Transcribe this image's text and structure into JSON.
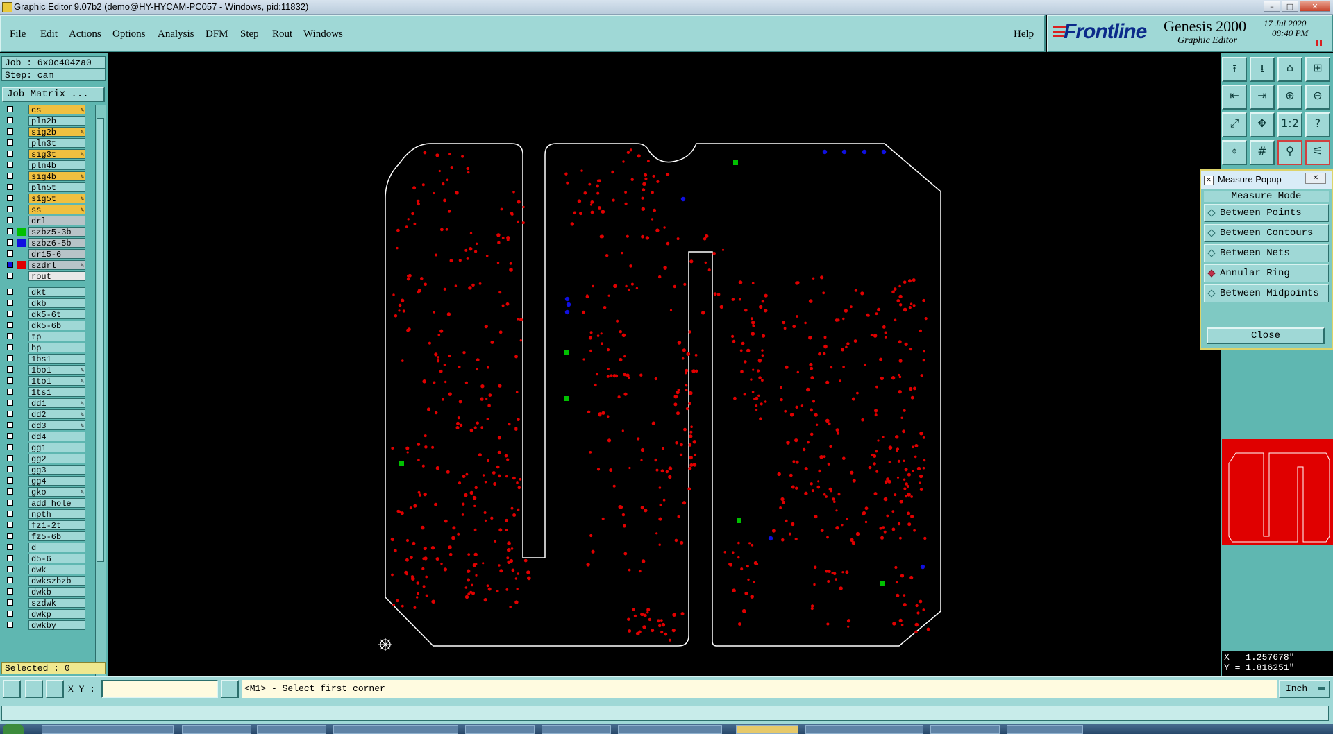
{
  "window": {
    "title": "Graphic Editor 9.07b2 (demo@HY-HYCAM-PC057 - Windows, pid:11832)"
  },
  "menu": [
    "File",
    "Edit",
    "Actions",
    "Options",
    "Analysis",
    "DFM",
    "Step",
    "Rout",
    "Windows"
  ],
  "help_label": "Help",
  "brand": {
    "logo": "Frontline",
    "product": "Genesis 2000",
    "subtitle": "Graphic Editor",
    "date": "17 Jul 2020",
    "time": "08:40 PM"
  },
  "job": {
    "job_line": "Job : 6x0c404za0",
    "step_line": "Step: cam",
    "job_matrix": "Job Matrix ..."
  },
  "layers": [
    {
      "name": "cs",
      "bg": "#f0c040",
      "swatch": "",
      "edit": true
    },
    {
      "name": "pln2b",
      "bg": "#9fd8d6",
      "swatch": "",
      "edit": false
    },
    {
      "name": "sig2b",
      "bg": "#f0c040",
      "swatch": "",
      "edit": true
    },
    {
      "name": "pln3t",
      "bg": "#9fd8d6",
      "swatch": "",
      "edit": false
    },
    {
      "name": "sig3t",
      "bg": "#f0c040",
      "swatch": "",
      "edit": true
    },
    {
      "name": "pln4b",
      "bg": "#9fd8d6",
      "swatch": "",
      "edit": false
    },
    {
      "name": "sig4b",
      "bg": "#f0c040",
      "swatch": "",
      "edit": true
    },
    {
      "name": "pln5t",
      "bg": "#9fd8d6",
      "swatch": "",
      "edit": false
    },
    {
      "name": "sig5t",
      "bg": "#f0c040",
      "swatch": "",
      "edit": true
    },
    {
      "name": "ss",
      "bg": "#f0c040",
      "swatch": "",
      "edit": true
    },
    {
      "name": "drl",
      "bg": "#b8c4c8",
      "swatch": "",
      "edit": false
    },
    {
      "name": "szbz5-3b",
      "bg": "#b8c4c8",
      "swatch": "#00c000",
      "edit": false
    },
    {
      "name": "szbz6-5b",
      "bg": "#b8c4c8",
      "swatch": "#1010e0",
      "edit": false
    },
    {
      "name": "dr15-6",
      "bg": "#b8c4c8",
      "swatch": "",
      "edit": false
    },
    {
      "name": "szdrl",
      "bg": "#b8c4c8",
      "swatch": "#e00000",
      "edit": true
    },
    {
      "name": "rout",
      "bg": "#e8e8e8",
      "swatch": "",
      "edit": false
    },
    {
      "name": "dkt",
      "bg": "#9fd8d6",
      "swatch": "",
      "edit": false
    },
    {
      "name": "dkb",
      "bg": "#9fd8d6",
      "swatch": "",
      "edit": false
    },
    {
      "name": "dk5-6t",
      "bg": "#9fd8d6",
      "swatch": "",
      "edit": false
    },
    {
      "name": "dk5-6b",
      "bg": "#9fd8d6",
      "swatch": "",
      "edit": false
    },
    {
      "name": "tp",
      "bg": "#9fd8d6",
      "swatch": "",
      "edit": false
    },
    {
      "name": "bp",
      "bg": "#9fd8d6",
      "swatch": "",
      "edit": false
    },
    {
      "name": "1bs1",
      "bg": "#9fd8d6",
      "swatch": "",
      "edit": false
    },
    {
      "name": "1bo1",
      "bg": "#9fd8d6",
      "swatch": "",
      "edit": true
    },
    {
      "name": "1to1",
      "bg": "#9fd8d6",
      "swatch": "",
      "edit": true
    },
    {
      "name": "1ts1",
      "bg": "#9fd8d6",
      "swatch": "",
      "edit": false
    },
    {
      "name": "dd1",
      "bg": "#9fd8d6",
      "swatch": "",
      "edit": true
    },
    {
      "name": "dd2",
      "bg": "#9fd8d6",
      "swatch": "",
      "edit": true
    },
    {
      "name": "dd3",
      "bg": "#9fd8d6",
      "swatch": "",
      "edit": true
    },
    {
      "name": "dd4",
      "bg": "#9fd8d6",
      "swatch": "",
      "edit": false
    },
    {
      "name": "gg1",
      "bg": "#9fd8d6",
      "swatch": "",
      "edit": false
    },
    {
      "name": "gg2",
      "bg": "#9fd8d6",
      "swatch": "",
      "edit": false
    },
    {
      "name": "gg3",
      "bg": "#9fd8d6",
      "swatch": "",
      "edit": false
    },
    {
      "name": "gg4",
      "bg": "#9fd8d6",
      "swatch": "",
      "edit": false
    },
    {
      "name": "gko",
      "bg": "#9fd8d6",
      "swatch": "",
      "edit": true
    },
    {
      "name": "add_hole",
      "bg": "#9fd8d6",
      "swatch": "",
      "edit": false
    },
    {
      "name": "npth",
      "bg": "#9fd8d6",
      "swatch": "",
      "edit": false
    },
    {
      "name": "fz1-2t",
      "bg": "#9fd8d6",
      "swatch": "",
      "edit": false
    },
    {
      "name": "fz5-6b",
      "bg": "#9fd8d6",
      "swatch": "",
      "edit": false
    },
    {
      "name": "d",
      "bg": "#9fd8d6",
      "swatch": "",
      "edit": false
    },
    {
      "name": "d5-6",
      "bg": "#9fd8d6",
      "swatch": "",
      "edit": false
    },
    {
      "name": "dwk",
      "bg": "#9fd8d6",
      "swatch": "",
      "edit": false
    },
    {
      "name": "dwkszbzb",
      "bg": "#9fd8d6",
      "swatch": "",
      "edit": false
    },
    {
      "name": "dwkb",
      "bg": "#9fd8d6",
      "swatch": "",
      "edit": false
    },
    {
      "name": "szdwk",
      "bg": "#9fd8d6",
      "swatch": "",
      "edit": false
    },
    {
      "name": "dwkp",
      "bg": "#9fd8d6",
      "swatch": "",
      "edit": false
    },
    {
      "name": "dwkby",
      "bg": "#9fd8d6",
      "swatch": "",
      "edit": false
    }
  ],
  "selected_text": "Selected : 0",
  "measure_popup": {
    "title": "Measure Popup",
    "mode_label": "Measure Mode",
    "options": [
      "Between Points",
      "Between Contours",
      "Between Nets",
      "Annular Ring",
      "Between Midpoints"
    ],
    "selected": "Annular Ring",
    "close_label": "Close"
  },
  "toolbar_icons": [
    "open-job-icon",
    "save-job-icon",
    "home-icon",
    "layout-icon",
    "zoom-back-icon",
    "zoom-forward-icon",
    "zoom-in-icon",
    "zoom-out-icon",
    "zoom-fit-icon",
    "pan-icon",
    "scale-1-2-icon",
    "help-icon",
    "snap-icon",
    "grid-icon",
    "measure-icon",
    "layers-compare-icon"
  ],
  "coords": {
    "x": "X = 1.257678\"",
    "y": "Y = 1.816251\""
  },
  "bottom": {
    "xy_label": "X Y :",
    "xy_value": "",
    "prompt": "<M1> - Select first corner",
    "unit": "Inch"
  },
  "colors": {
    "background": "#000000",
    "panel": "#9fd8d6",
    "board_outline": "#ffffff",
    "drill_holes": "#e00000",
    "via_green": "#00c000",
    "via_blue": "#1010e0"
  }
}
